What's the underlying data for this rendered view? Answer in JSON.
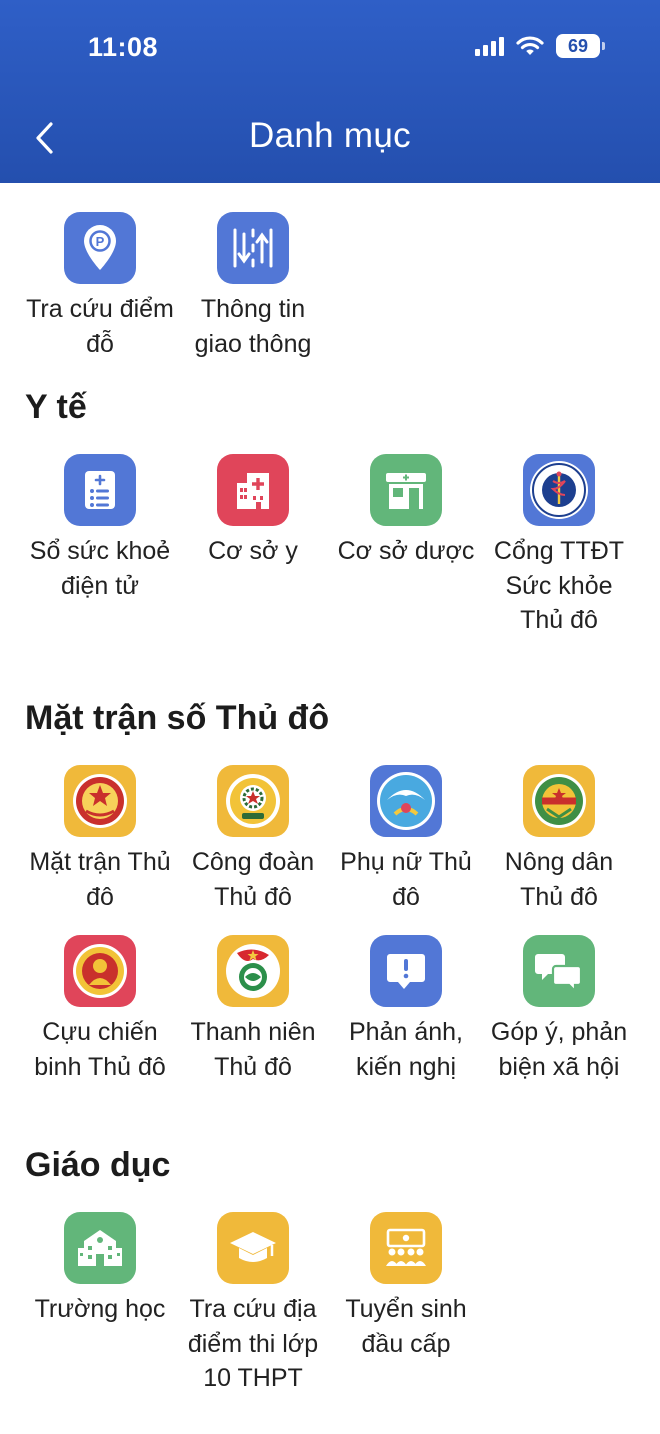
{
  "status_bar": {
    "time": "11:08",
    "battery": "69"
  },
  "header": {
    "title": "Danh mục"
  },
  "top_items": [
    {
      "label": "Tra cứu điểm đỗ",
      "icon": "parking-location-icon",
      "color": "#5277d6"
    },
    {
      "label": "Thông tin giao thông",
      "icon": "traffic-lanes-icon",
      "color": "#5277d6"
    }
  ],
  "sections": [
    {
      "title": "Y tế",
      "items": [
        {
          "label": "Sổ sức khoẻ điện tử",
          "icon": "health-record-icon",
          "color": "#5277d6"
        },
        {
          "label": "Cơ sở y",
          "icon": "hospital-icon",
          "color": "#e0455a"
        },
        {
          "label": "Cơ sở dược",
          "icon": "pharmacy-icon",
          "color": "#62b67a"
        },
        {
          "label": "Cổng TTĐT Sức khỏe Thủ đô",
          "icon": "health-department-emblem-icon",
          "color": "#5277d6"
        }
      ]
    },
    {
      "title": "Mặt trận số Thủ đô",
      "items": [
        {
          "label": "Mặt trận Thủ đô",
          "icon": "fatherland-front-emblem-icon",
          "color": "#f0b93a"
        },
        {
          "label": "Công đoàn Thủ đô",
          "icon": "trade-union-emblem-icon",
          "color": "#f0b93a"
        },
        {
          "label": "Phụ nữ Thủ đô",
          "icon": "women-union-emblem-icon",
          "color": "#5277d6"
        },
        {
          "label": "Nông dân Thủ đô",
          "icon": "farmers-union-emblem-icon",
          "color": "#f0b93a"
        },
        {
          "label": "Cựu chiến binh Thủ đô",
          "icon": "veterans-emblem-icon",
          "color": "#e0455a"
        },
        {
          "label": "Thanh niên Thủ đô",
          "icon": "youth-union-emblem-icon",
          "color": "#f0b93a"
        },
        {
          "label": "Phản ánh, kiến nghị",
          "icon": "feedback-alert-icon",
          "color": "#5277d6"
        },
        {
          "label": "Góp ý, phản biện xã hội",
          "icon": "chat-bubbles-icon",
          "color": "#62b67a"
        }
      ]
    },
    {
      "title": "Giáo dục",
      "items": [
        {
          "label": "Trường học",
          "icon": "school-icon",
          "color": "#62b67a"
        },
        {
          "label": "Tra cứu địa điểm thi lớp 10 THPT",
          "icon": "graduation-cap-icon",
          "color": "#f0b93a"
        },
        {
          "label": "Tuyển sinh đầu cấp",
          "icon": "classroom-icon",
          "color": "#f0b93a"
        }
      ]
    }
  ]
}
